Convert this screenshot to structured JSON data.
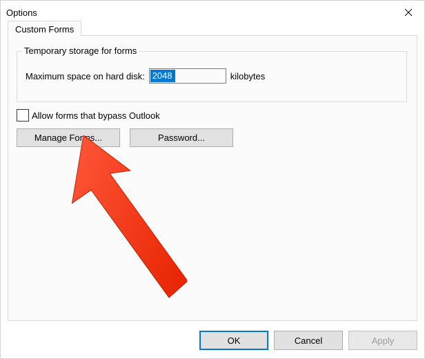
{
  "window": {
    "title": "Options"
  },
  "tab": {
    "label": "Custom Forms"
  },
  "group": {
    "legend": "Temporary storage for forms",
    "max_space_label": "Maximum space on hard disk:",
    "max_space_value": "2048",
    "unit_label": "kilobytes"
  },
  "checkbox": {
    "label": "Allow forms that bypass Outlook"
  },
  "buttons": {
    "manage_forms": "Manage Forms...",
    "password": "Password..."
  },
  "footer": {
    "ok": "OK",
    "cancel": "Cancel",
    "apply": "Apply"
  },
  "annotation": {
    "color": "#ff3b24"
  }
}
